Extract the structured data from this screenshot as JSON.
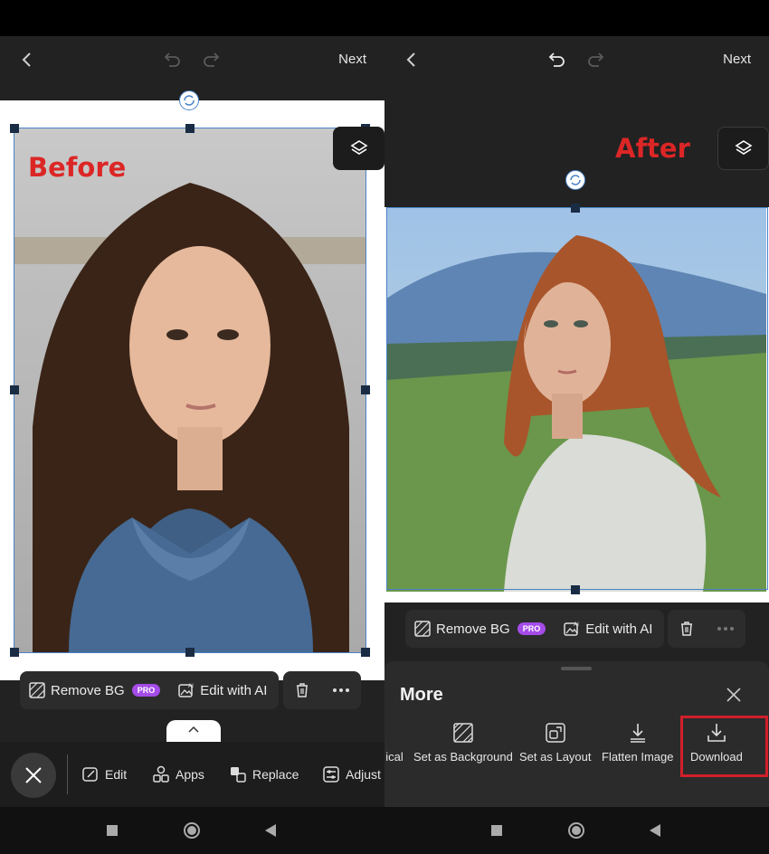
{
  "colors": {
    "accent_selection": "#4a83c7",
    "label_red": "#dc2626",
    "pro_badge": "#a44be8",
    "highlight_box": "#d11f2a"
  },
  "left": {
    "topbar": {
      "next_label": "Next"
    },
    "overlay_label": "Before",
    "toolbar": {
      "remove_bg_label": "Remove BG",
      "pro_badge": "PRO",
      "edit_ai_label": "Edit with AI"
    },
    "bottom_nav": {
      "edit_label": "Edit",
      "apps_label": "Apps",
      "replace_label": "Replace",
      "adjust_label": "Adjust"
    }
  },
  "right": {
    "topbar": {
      "next_label": "Next"
    },
    "overlay_label": "After",
    "toolbar": {
      "remove_bg_label": "Remove BG",
      "pro_badge": "PRO",
      "edit_ai_label": "Edit with AI"
    },
    "sheet": {
      "title": "More",
      "items": [
        {
          "label": "ical",
          "icon": "partial-icon"
        },
        {
          "label": "Set as Background",
          "icon": "set-background-icon"
        },
        {
          "label": "Set as Layout",
          "icon": "set-layout-icon"
        },
        {
          "label": "Flatten Image",
          "icon": "flatten-icon"
        },
        {
          "label": "Download",
          "icon": "download-icon"
        }
      ]
    }
  }
}
